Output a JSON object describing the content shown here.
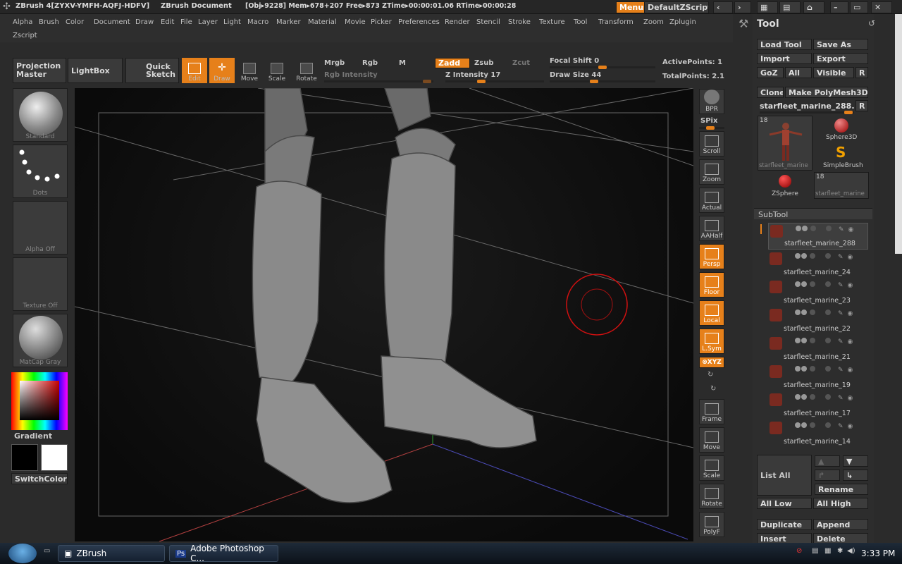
{
  "titlebar": {
    "app": "ZBrush 4[ZYXV-YMFH-AQFJ-HDFV]",
    "doc": "ZBrush Document",
    "obj": "[Obj▸9228] Mem▸678+207  Free▸873  ZTime▸00:00:01.06  RTime▸00:00:28",
    "menus_btn": "Menus",
    "script_btn": "DefaultZScript"
  },
  "menus": [
    "Alpha",
    "Brush",
    "Color",
    "Document",
    "Draw",
    "Edit",
    "File",
    "Layer",
    "Light",
    "Macro",
    "Marker",
    "Material",
    "Movie",
    "Picker",
    "Preferences",
    "Render",
    "Stencil",
    "Stroke",
    "Texture",
    "Tool",
    "Transform",
    "Zoom",
    "Zplugin"
  ],
  "menus_row2": [
    "Zscript"
  ],
  "shelf": {
    "projection_master": "Projection Master",
    "lightbox": "LightBox",
    "quick_sketch": "Quick Sketch",
    "edit": "Edit",
    "draw": "Draw",
    "move": "Move",
    "scale": "Scale",
    "rotate": "Rotate",
    "mrgb": "Mrgb",
    "rgb": "Rgb",
    "m": "M",
    "zadd": "Zadd",
    "zsub": "Zsub",
    "zcut": "Zcut",
    "rgb_intensity": "Rgb Intensity",
    "z_intensity": "Z Intensity 17",
    "focal_shift": "Focal Shift 0",
    "draw_size": "Draw Size 44",
    "active_points": "ActivePoints: 1",
    "total_points": "TotalPoints: 2.1"
  },
  "left": {
    "standard": "Standard",
    "dots": "Dots",
    "alpha_off": "Alpha Off",
    "texture_off": "Texture Off",
    "matcap": "MatCap Gray",
    "gradient": "Gradient",
    "switchcolor": "SwitchColor"
  },
  "right": {
    "bpr": "BPR",
    "spix": "SPix",
    "scroll": "Scroll",
    "zoom": "Zoom",
    "actual": "Actual",
    "aahalf": "AAHalf",
    "persp": "Persp",
    "floor": "Floor",
    "local": "Local",
    "lsym": "L.Sym",
    "xyz": "⊗XYZ",
    "frame": "Frame",
    "move": "Move",
    "scale": "Scale",
    "rotate": "Rotate",
    "polyf": "PolyF"
  },
  "tool": {
    "title": "Tool",
    "load_tool": "Load Tool",
    "save_as": "Save As",
    "import": "Import",
    "export": "Export",
    "goz": "GoZ",
    "all": "All",
    "visible": "Visible",
    "r": "R",
    "clone": "Clone",
    "make_polymesh": "Make PolyMesh3D",
    "current": "starfleet_marine_288.",
    "r2": "R",
    "thumb_count": "18",
    "thumb1": "starfleet_marine",
    "sphere3d": "Sphere3D",
    "simplebrush": "SimpleBrush",
    "zsphere": "ZSphere",
    "thumb_count2": "18",
    "thumb2": "starfleet_marine"
  },
  "subtool": {
    "title": "SubTool",
    "items": [
      "starfleet_marine_288",
      "starfleet_marine_24",
      "starfleet_marine_23",
      "starfleet_marine_22",
      "starfleet_marine_21",
      "starfleet_marine_19",
      "starfleet_marine_17",
      "starfleet_marine_14"
    ],
    "list_all": "List All",
    "rename": "Rename",
    "all_low": "All Low",
    "all_high": "All High",
    "duplicate": "Duplicate",
    "append": "Append",
    "insert": "Insert",
    "delete": "Delete"
  },
  "taskbar": {
    "zbrush": "ZBrush",
    "photoshop": "Adobe Photoshop C...",
    "clock": "3:33 PM"
  },
  "colors": {
    "accent": "#e6801a",
    "panel": "#2d2d2d",
    "canvas": "#111111"
  }
}
